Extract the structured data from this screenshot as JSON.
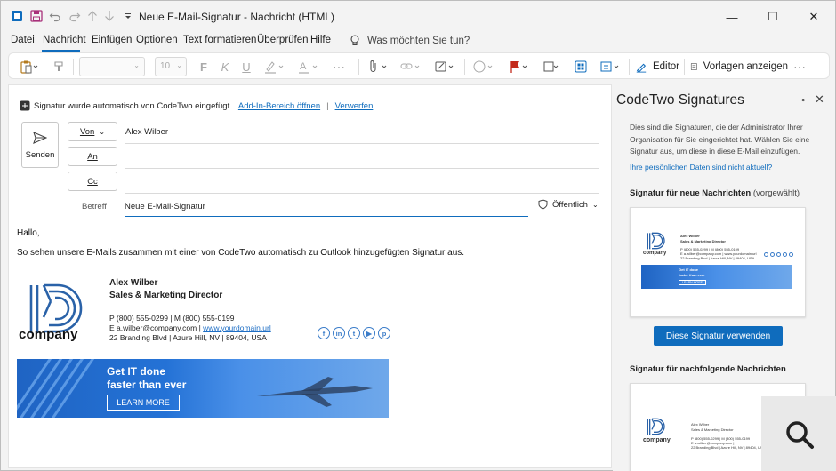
{
  "window": {
    "title": "Neue E-Mail-Signatur  -  Nachricht (HTML)",
    "minimize": "—",
    "maximize": "☐",
    "close": "✕"
  },
  "menu": {
    "items": [
      "Datei",
      "Nachricht",
      "Einfügen",
      "Optionen",
      "Text formatieren",
      "Überprüfen",
      "Hilfe"
    ],
    "active_index": 1,
    "search_hint": "Was möchten Sie tun?"
  },
  "ribbon": {
    "font_size": "10",
    "editor_label": "Editor",
    "templates_label": "Vorlagen anzeigen"
  },
  "notice": {
    "text": "Signatur wurde automatisch von CodeTwo eingefügt.",
    "link1": "Add-In-Bereich öffnen",
    "link2": "Verwerfen"
  },
  "compose": {
    "send_label": "Senden",
    "from_label": "Von",
    "to_label": "An",
    "cc_label": "Cc",
    "from_value": "Alex Wilber",
    "subject_label": "Betreff",
    "subject_value": "Neue E-Mail-Signatur",
    "sensitivity": "Öffentlich"
  },
  "body": {
    "greeting": "Hallo,",
    "text": "So sehen unsere E-Mails zusammen mit einer von CodeTwo automatisch zu Outlook hinzugefügten Signatur aus."
  },
  "signature": {
    "logo_word": "company",
    "name": "Alex Wilber",
    "title": "Sales & Marketing Director",
    "phone_line": "P (800) 555-0299 | M (800) 555-0199",
    "email_prefix": "E a.wilber@company.com | ",
    "website": "www.yourdomain.url",
    "address": "22 Branding Blvd | Azure Hill, NV | 89404, USA",
    "social": [
      "f",
      "in",
      "t",
      "▶",
      "p"
    ],
    "banner_line1": "Get IT done",
    "banner_line2": "faster than ever",
    "banner_button": "LEARN MORE",
    "accent_color": "#1f64c3"
  },
  "pane": {
    "title": "CodeTwo Signatures",
    "description": "Dies sind die Signaturen, die der Administrator Ihrer Organisation für Sie eingerichtet hat. Wählen Sie eine Signatur aus, um diese in diese E-Mail einzufügen.",
    "link": "Ihre persönlichen Daten sind nicht aktuell?",
    "section1_title": "Signatur für neue Nachrichten",
    "section1_note": "(vorgewählt)",
    "use_button": "Diese Signatur verwenden",
    "section2_title": "Signatur für nachfolgende Nachrichten"
  }
}
